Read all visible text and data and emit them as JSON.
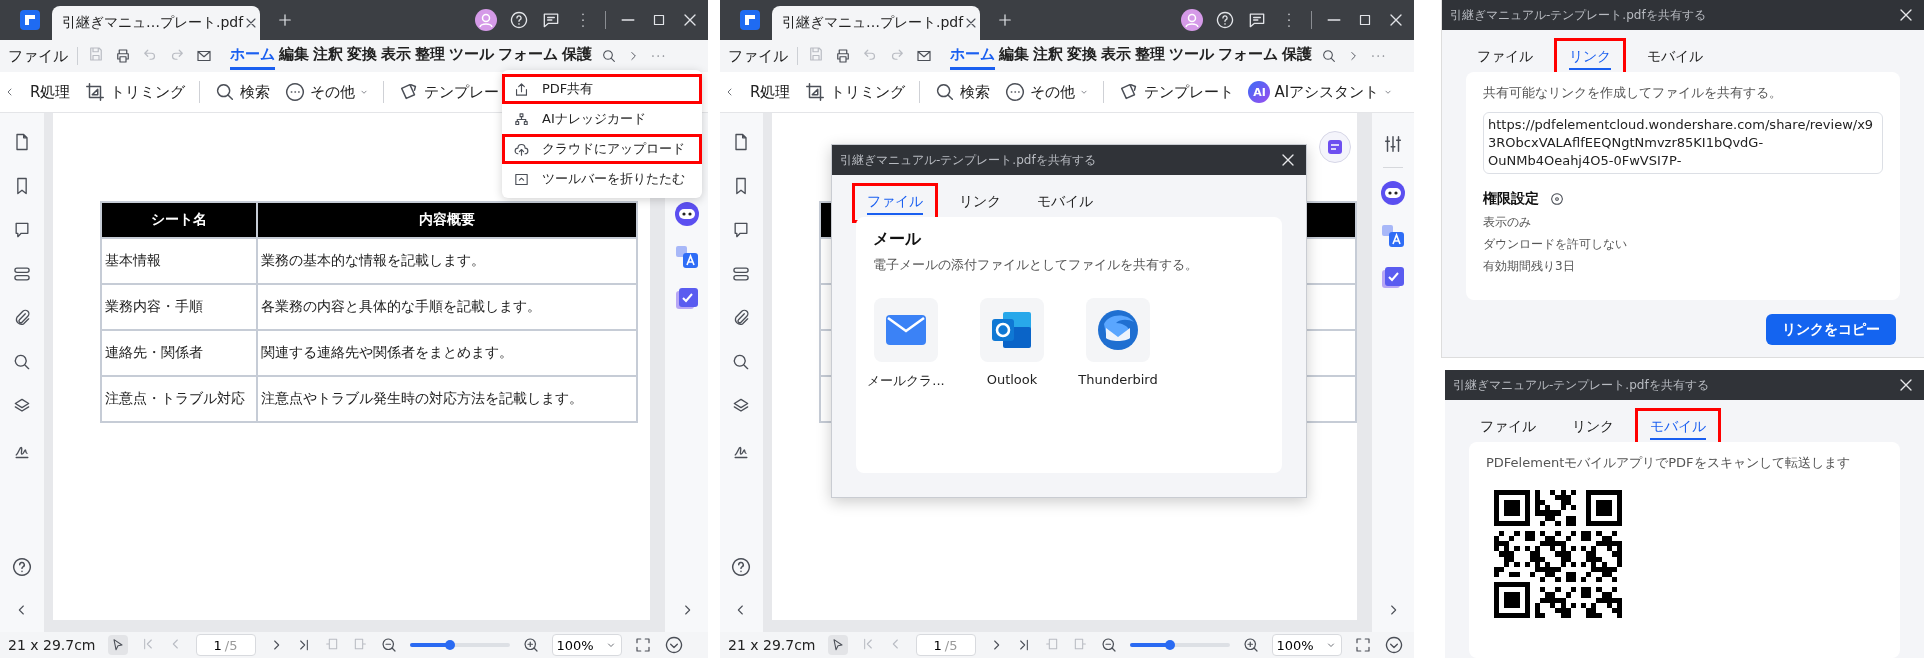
{
  "app_windows": [
    {
      "tab_title": "引継ぎマニュ…プレート.pdf",
      "file_menu": "ファイル",
      "ribbon_tabs": [
        {
          "label": "ホーム",
          "selected": true
        },
        {
          "label": "編集",
          "selected": false
        },
        {
          "label": "注釈",
          "selected": false
        },
        {
          "label": "変換",
          "selected": false
        },
        {
          "label": "表示",
          "selected": false
        },
        {
          "label": "整理",
          "selected": false
        },
        {
          "label": "ツール",
          "selected": false
        },
        {
          "label": "フォーム",
          "selected": false
        },
        {
          "label": "保護",
          "selected": false
        }
      ],
      "toolbar": [
        {
          "label": "R処理",
          "kind": "text"
        },
        {
          "label": "トリミング",
          "kind": "crop"
        },
        {
          "label": "検索",
          "kind": "search"
        },
        {
          "label": "その他",
          "kind": "more",
          "dropdown": true
        },
        {
          "label": "テンプレー",
          "kind": "template"
        }
      ],
      "dropdown_menu": [
        {
          "label": "PDF共有",
          "kind": "share",
          "highlighted": true
        },
        {
          "label": "AIナレッジカード",
          "kind": "knowledge",
          "highlighted": false
        },
        {
          "label": "クラウドにアップロード",
          "kind": "upload",
          "highlighted": true
        },
        {
          "label": "ツールバーを折りたたむ",
          "kind": "collapse",
          "highlighted": false
        }
      ],
      "table": {
        "columns": [
          "シート名",
          "内容概要"
        ],
        "rows": [
          [
            "基本情報",
            "業務の基本的な情報を記載します。"
          ],
          [
            "業務内容・手順",
            "各業務の内容と具体的な手順を記載します。"
          ],
          [
            "連絡先・関係者",
            "関連する連絡先や関係者をまとめます。"
          ],
          [
            "注意点・トラブル対応",
            "注意点やトラブル発生時の対応方法を記載します。"
          ]
        ]
      },
      "status_bar": {
        "page_size": "21 x 29.7cm",
        "page": "1",
        "page_count": "/5",
        "zoom": "100%",
        "level": 0.4
      }
    },
    {
      "tab_title": "引継ぎマニュ…プレート.pdf",
      "file_menu": "ファイル",
      "ribbon_tabs": [
        {
          "label": "ホーム",
          "selected": true
        },
        {
          "label": "編集",
          "selected": false
        },
        {
          "label": "注釈",
          "selected": false
        },
        {
          "label": "変換",
          "selected": false
        },
        {
          "label": "表示",
          "selected": false
        },
        {
          "label": "整理",
          "selected": false
        },
        {
          "label": "ツール",
          "selected": false
        },
        {
          "label": "フォーム",
          "selected": false
        },
        {
          "label": "保護",
          "selected": false
        }
      ],
      "toolbar": [
        {
          "label": "R処理",
          "kind": "text"
        },
        {
          "label": "トリミング",
          "kind": "crop"
        },
        {
          "label": "検索",
          "kind": "search"
        },
        {
          "label": "その他",
          "kind": "more",
          "dropdown": true
        },
        {
          "label": "テンプレート",
          "kind": "template"
        },
        {
          "label": "AIアシスタント",
          "kind": "ai",
          "badge": "AI",
          "dropdown": true
        }
      ],
      "share_dialog": {
        "title": "引継ぎマニュアル-テンプレート.pdfを共有する",
        "tabs": [
          {
            "label": "ファイル",
            "selected": true,
            "highlighted": true
          },
          {
            "label": "リンク",
            "selected": false,
            "highlighted": false
          },
          {
            "label": "モバイル",
            "selected": false,
            "highlighted": false
          }
        ],
        "panel": {
          "kind": "file",
          "heading": "メール",
          "description": "電子メールの添付ファイルとしてファイルを共有する。",
          "apps": [
            {
              "label": "メールクラ...",
              "kind": "mail"
            },
            {
              "label": "Outlook",
              "kind": "outlook"
            },
            {
              "label": "Thunderbird",
              "kind": "thunderbird"
            }
          ]
        }
      },
      "status_bar": {
        "page_size": "21 x 29.7cm",
        "page": "1",
        "page_count": "/5",
        "zoom": "100%",
        "level": 0.4
      }
    }
  ],
  "share_dialogs": [
    {
      "title": "引継ぎマニュアル-テンプレート.pdfを共有する",
      "tabs": [
        {
          "label": "ファイル",
          "selected": false,
          "highlighted": false
        },
        {
          "label": "リンク",
          "selected": true,
          "highlighted": true
        },
        {
          "label": "モバイル",
          "selected": false,
          "highlighted": false
        }
      ],
      "panel": {
        "kind": "link",
        "description": "共有可能なリンクを作成してファイルを共有する。",
        "url": "https://pdfelementcloud.wondershare.com/share/review/x93RObcxVALAflfEEQNgtNmvzr85KI1bQvdG-OuNMb4Oeahj4O5-0FwVSI7P-",
        "permissions_heading": "権限設定",
        "permissions": [
          "表示のみ",
          "ダウンロードを許可しない",
          "有効期間残り3日"
        ],
        "copy_button": "リンクをコピー"
      }
    },
    {
      "title": "引継ぎマニュアル-テンプレート.pdfを共有する",
      "tabs": [
        {
          "label": "ファイル",
          "selected": false,
          "highlighted": false
        },
        {
          "label": "リンク",
          "selected": false,
          "highlighted": false
        },
        {
          "label": "モバイル",
          "selected": true,
          "highlighted": true
        }
      ],
      "panel": {
        "kind": "mobile",
        "description": "PDFelementモバイルアプリでPDFをスキャンして転送します"
      }
    }
  ]
}
